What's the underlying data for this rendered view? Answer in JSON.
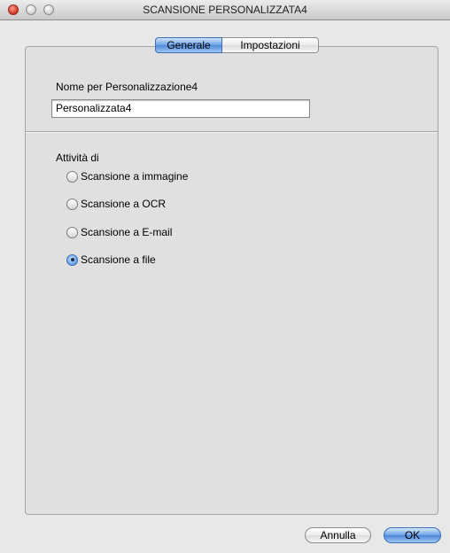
{
  "window": {
    "title": "SCANSIONE PERSONALIZZATA4"
  },
  "tabs": [
    {
      "label": "Generale",
      "selected": true
    },
    {
      "label": "Impostazioni",
      "selected": false
    }
  ],
  "name_section": {
    "label": "Nome per Personalizzazione4",
    "value": "Personalizzata4"
  },
  "activity": {
    "label": "Attività di",
    "options": [
      {
        "label": "Scansione a immagine",
        "selected": false
      },
      {
        "label": "Scansione a OCR",
        "selected": false
      },
      {
        "label": "Scansione a E-mail",
        "selected": false
      },
      {
        "label": "Scansione a file",
        "selected": true
      }
    ]
  },
  "buttons": {
    "cancel": "Annulla",
    "ok": "OK"
  },
  "colors": {
    "accent": "#5b95df",
    "window_bg": "#e8e8e8",
    "close_button": "#d0321e"
  }
}
